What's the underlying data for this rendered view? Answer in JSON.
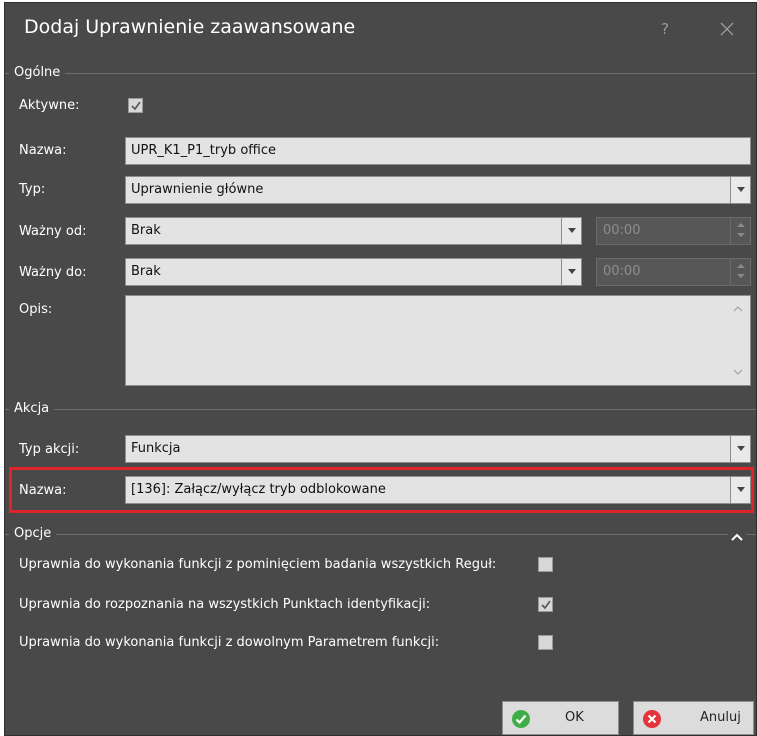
{
  "window": {
    "title": "Dodaj Uprawnienie zaawansowane",
    "help_glyph": "?"
  },
  "general": {
    "group_title": "Ogólne",
    "active_label": "Aktywne:",
    "active_checked": true,
    "name_label": "Nazwa:",
    "name_value": "UPR_K1_P1_tryb office",
    "type_label": "Typ:",
    "type_value": "Uprawnienie główne",
    "valid_from_label": "Ważny od:",
    "valid_from_value": "Brak",
    "valid_from_time": "00:00",
    "valid_to_label": "Ważny do:",
    "valid_to_value": "Brak",
    "valid_to_time": "00:00",
    "description_label": "Opis:",
    "description_value": ""
  },
  "action": {
    "group_title": "Akcja",
    "action_type_label": "Typ akcji:",
    "action_type_value": "Funkcja",
    "name_label": "Nazwa:",
    "name_value": "[136]: Załącz/wyłącz tryb odblokowane"
  },
  "options": {
    "group_title": "Opcje",
    "items": [
      {
        "label": "Uprawnia do wykonania funkcji z pominięciem badania wszystkich Reguł:",
        "checked": false
      },
      {
        "label": "Uprawnia do rozpoznania na wszystkich Punktach identyfikacji:",
        "checked": true
      },
      {
        "label": "Uprawnia do wykonania funkcji z dowolnym Parametrem funkcji:",
        "checked": false
      }
    ]
  },
  "buttons": {
    "ok_label": "OK",
    "cancel_label": "Anuluj"
  },
  "colors": {
    "background": "#494949",
    "highlight": "#e0242a",
    "ok_icon": "#3fae49",
    "cancel_icon": "#e3343c"
  }
}
